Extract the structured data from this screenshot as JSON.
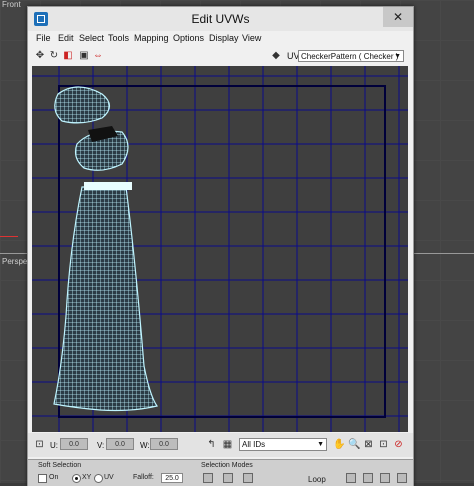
{
  "background": {
    "viewport_label_top": "Front",
    "viewport_label_mid": "Perspec"
  },
  "window": {
    "title": "Edit UVWs",
    "close_glyph": "✕"
  },
  "menu": {
    "items": [
      "File",
      "Edit",
      "Select",
      "Tools",
      "Mapping",
      "Options",
      "Display",
      "View"
    ]
  },
  "toolbar": {
    "icons": [
      "move-icon",
      "rotate-icon",
      "scale-icon",
      "freeform-icon",
      "mirror-icon"
    ],
    "uv_label": "UV",
    "map_select": "CheckerPattern  ( Checker )"
  },
  "bottom": {
    "u_label": "U:",
    "v_label": "V:",
    "w_label": "W:",
    "u_value": "0.0",
    "v_value": "0.0",
    "w_value": "0.0",
    "ids_select": "All IDs"
  },
  "rollout": {
    "soft_selection_label": "Soft Selection",
    "on_label": "On",
    "xy_label": "XY",
    "uv_label": "UV",
    "falloff_label": "Falloff:",
    "falloff_value": "25.0",
    "selection_modes_label": "Selection Modes",
    "loop_label": "Loop"
  },
  "colors": {
    "canvas_bg": "#3f3f3f",
    "grid_line": "#0b0b8a",
    "border_line": "#00003a",
    "uv_mesh": "#bff4ff"
  }
}
